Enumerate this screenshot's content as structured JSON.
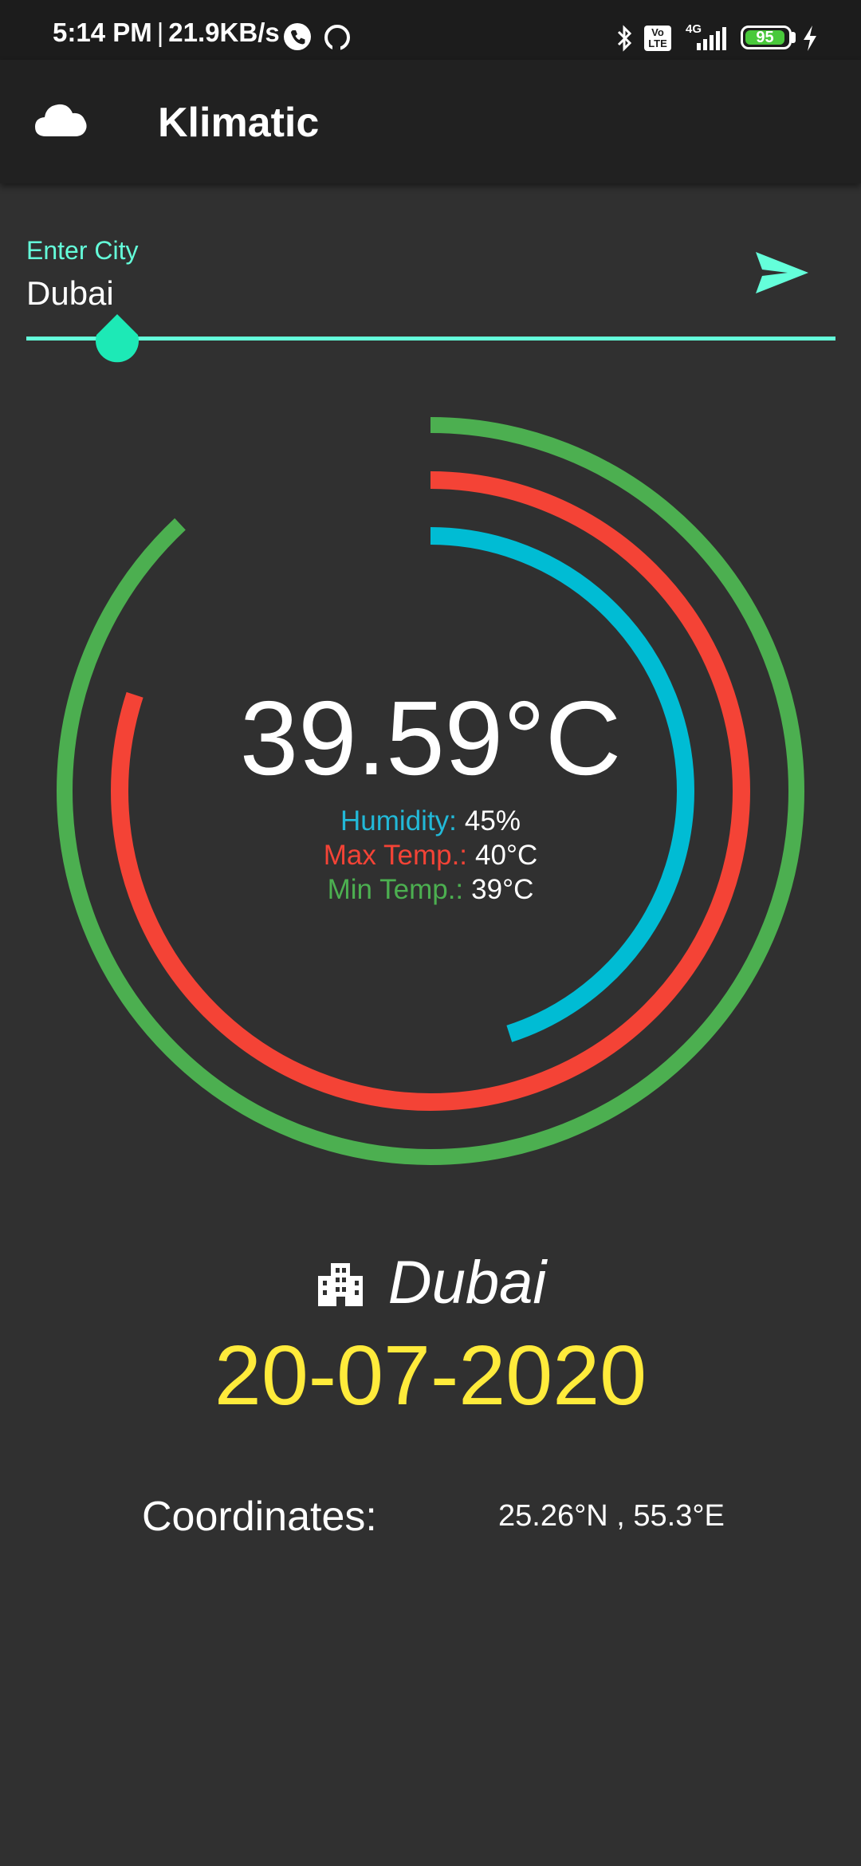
{
  "status_bar": {
    "time": "5:14 PM",
    "speed": "21.9KB/s",
    "network": "4G",
    "volte": "Vo LTE",
    "battery": "95",
    "icons": [
      "phone-icon",
      "circle-icon",
      "bluetooth-icon",
      "volte-icon",
      "signal-icon",
      "battery-icon",
      "charging-icon"
    ]
  },
  "app_bar": {
    "title": "Klimatic",
    "icon": "cloud-icon"
  },
  "city_input": {
    "label": "Enter City",
    "value": "Dubai",
    "send_icon": "send-icon"
  },
  "weather": {
    "temperature": "39.59°C",
    "humidity_label": "Humidity:",
    "humidity_value": "45%",
    "max_label": "Max Temp.:",
    "max_value": "40°C",
    "min_label": "Min Temp.:",
    "min_value": "39°C",
    "humidity_fraction": 0.45,
    "max_fraction": 0.8,
    "min_fraction": 0.88
  },
  "location": {
    "city": "Dubai",
    "city_icon": "building-icon",
    "date": "20-07-2020",
    "coords_label": "Coordinates:",
    "coords_value": "25.26°N , 55.3°E"
  },
  "colors": {
    "background": "#303030",
    "app_bar": "#212121",
    "accent": "#64ffda",
    "humidity": "#00bcd4",
    "max_temp": "#f44336",
    "min_temp": "#4caf50",
    "date": "#ffeb3b"
  }
}
